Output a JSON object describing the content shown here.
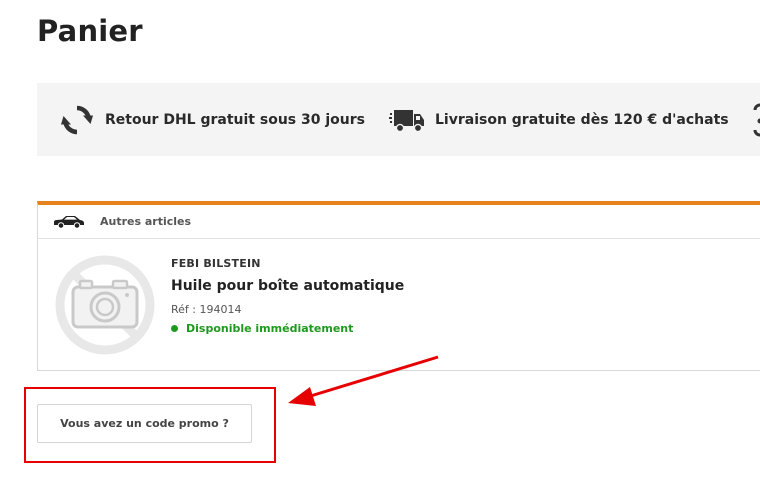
{
  "page": {
    "title": "Panier"
  },
  "benefits": [
    {
      "icon": "refresh-arrows-icon",
      "text": "Retour DHL gratuit sous 30 jours"
    },
    {
      "icon": "delivery-truck-icon",
      "text": "Livraison gratuite dès 120 € d'achats"
    },
    {
      "icon": "partial-icon",
      "text": ""
    }
  ],
  "cart": {
    "accent_color": "#e8821d",
    "group_icon": "car-icon",
    "group_label": "Autres articles",
    "items": [
      {
        "image_icon": "no-photo-camera-icon",
        "brand": "FEBI BILSTEIN",
        "name": "Huile pour boîte automatique",
        "ref": "Réf : 194014",
        "availability": "Disponible immédiatement",
        "availability_color": "#1d9a1d"
      }
    ]
  },
  "promo": {
    "button_label": "Vous avez un code promo ?"
  },
  "annotation": {
    "color": "#e60000"
  }
}
